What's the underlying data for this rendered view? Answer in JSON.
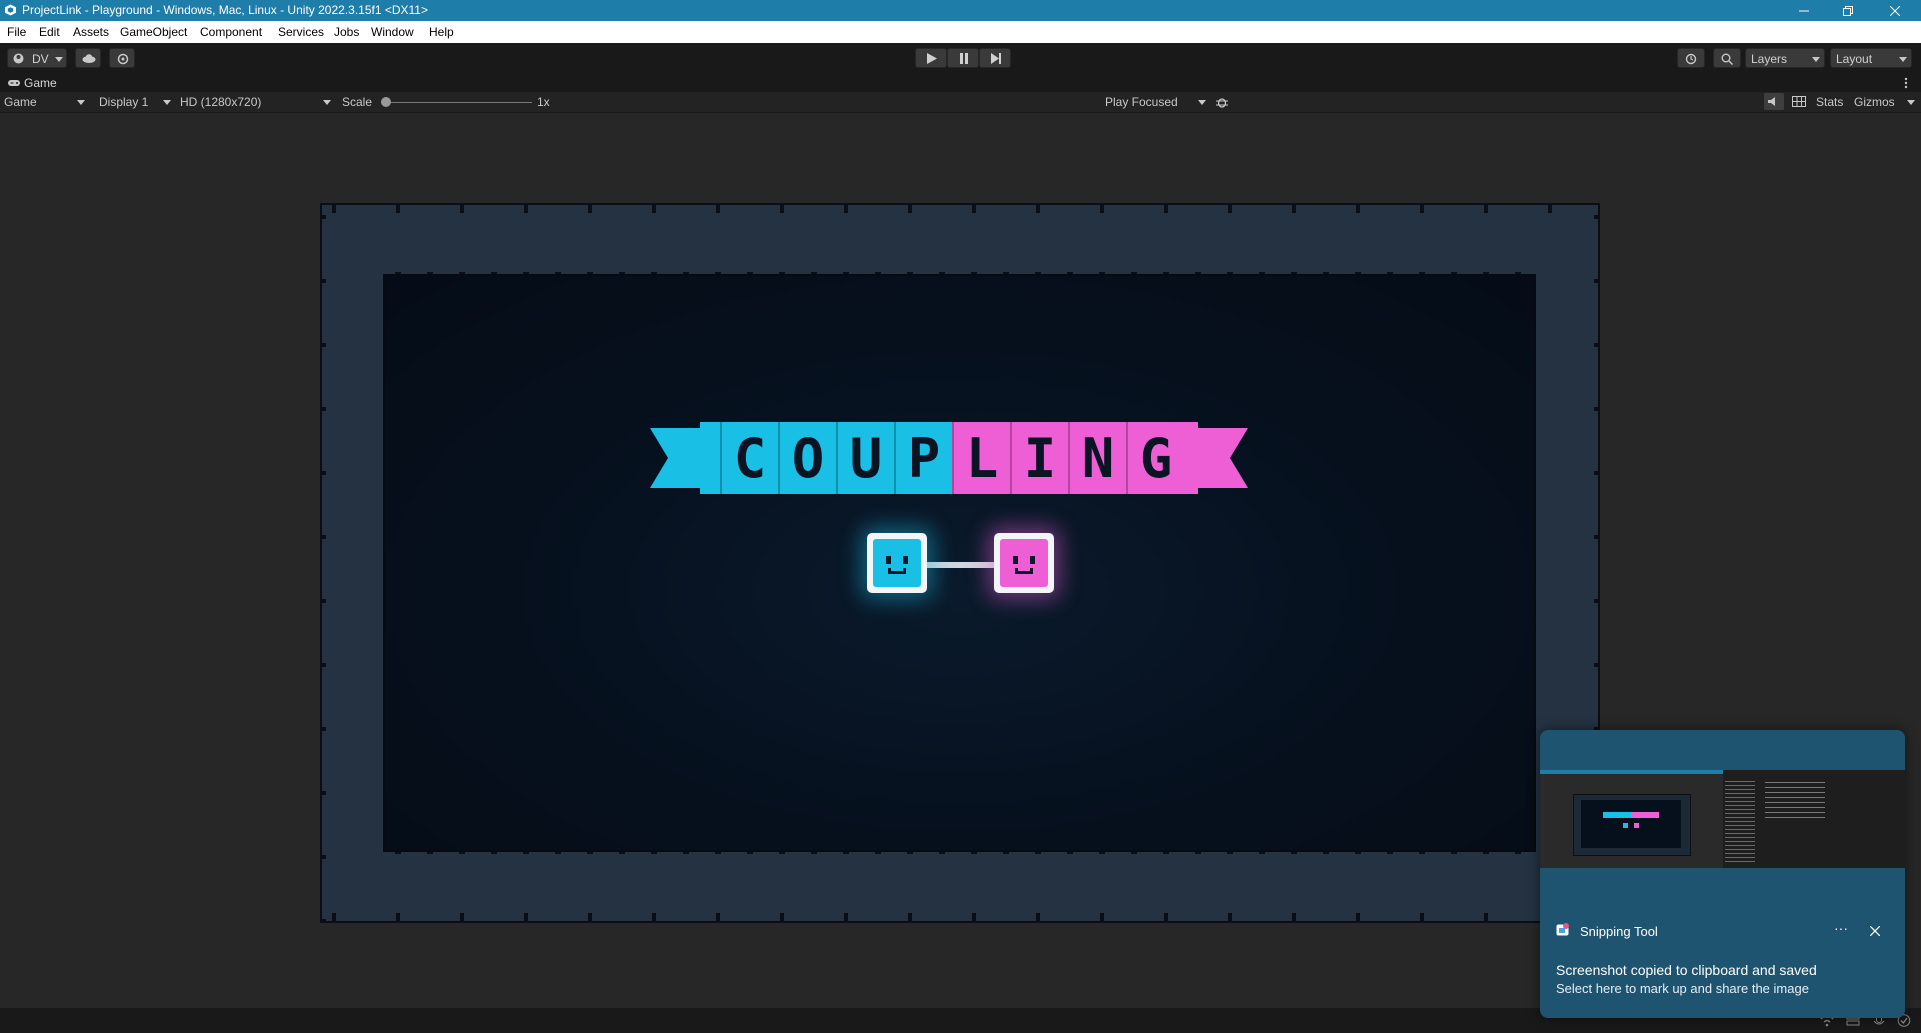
{
  "window": {
    "title": "ProjectLink - Playground - Windows, Mac, Linux - Unity 2022.3.15f1 <DX11>",
    "controls": [
      "minimize-icon",
      "restore-icon",
      "close-icon"
    ]
  },
  "menu": {
    "items": [
      "File",
      "Edit",
      "Assets",
      "GameObject",
      "Component",
      "Services",
      "Jobs",
      "Window",
      "Help"
    ]
  },
  "toolbar": {
    "account": "DV",
    "layers": "Layers",
    "layout": "Layout"
  },
  "tab": {
    "label": "Game"
  },
  "gamebar": {
    "mode": "Game",
    "display": "Display 1",
    "resolution": "HD (1280x720)",
    "scale_label": "Scale",
    "scale_value": "1x",
    "play_focused": "Play Focused",
    "stats": "Stats",
    "gizmos": "Gizmos"
  },
  "game": {
    "title_letters": [
      "C",
      "O",
      "U",
      "P",
      "L",
      "I",
      "N",
      "G"
    ],
    "colors": {
      "cyan": "#19bfe5",
      "pink": "#ee5fd6",
      "frame": "#243242",
      "arena": "#06101d"
    }
  },
  "toast": {
    "app": "Snipping Tool",
    "title": "Screenshot copied to clipboard and saved",
    "subtitle": "Select here to mark up and share the image",
    "more": "···"
  }
}
